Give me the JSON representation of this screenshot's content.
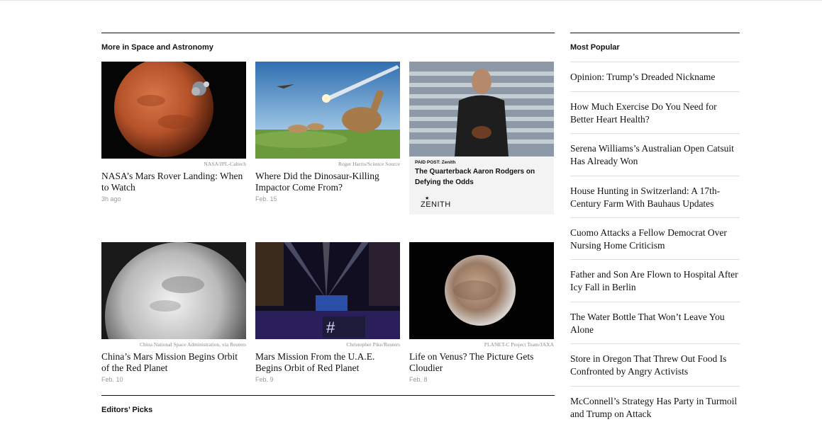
{
  "section": {
    "title": "More in Space and Astronomy",
    "cards": [
      {
        "credit": "NASA/JPL-Caltech",
        "headline": "NASA’s Mars Rover Landing: When to Watch",
        "date": "3h ago"
      },
      {
        "credit": "Roger Harris/Science Source",
        "headline": "Where Did the Dinosaur-Killing Impactor Come From?",
        "date": "Feb. 15"
      },
      {
        "credit": "China National Space Administration, via Reuters",
        "headline": "China’s Mars Mission Begins Orbit of the Red Planet",
        "date": "Feb. 10"
      },
      {
        "credit": "Christopher Pike/Reuters",
        "headline": "Mars Mission From the U.A.E. Begins Orbit of Red Planet",
        "date": "Feb. 9"
      },
      {
        "credit": "PLANET-C Project Team/JAXA",
        "headline": "Life on Venus? The Picture Gets Cloudier",
        "date": "Feb. 8"
      }
    ],
    "paid": {
      "label": "PAID POST: Zenith",
      "headline": "The Quarterback Aaron Rodgers on Defying the Odds",
      "logo": "ZENITH"
    }
  },
  "editors_picks": {
    "title": "Editors’ Picks"
  },
  "sidebar": {
    "title": "Most Popular",
    "items": [
      "Opinion: Trump’s Dreaded Nickname",
      "How Much Exercise Do You Need for Better Heart Health?",
      "Serena Williams’s Australian Open Catsuit Has Already Won",
      "House Hunting in Switzerland: A 17th-Century Farm With Bauhaus Updates",
      "Cuomo Attacks a Fellow Democrat Over Nursing Home Criticism",
      "Father and Son Are Flown to Hospital After Icy Fall in Berlin",
      "The Water Bottle That Won’t Leave You Alone",
      "Store in Oregon That Threw Out Food Is Confronted by Angry Activists",
      "McConnell’s Strategy Has Party in Turmoil and Trump on Attack"
    ]
  }
}
